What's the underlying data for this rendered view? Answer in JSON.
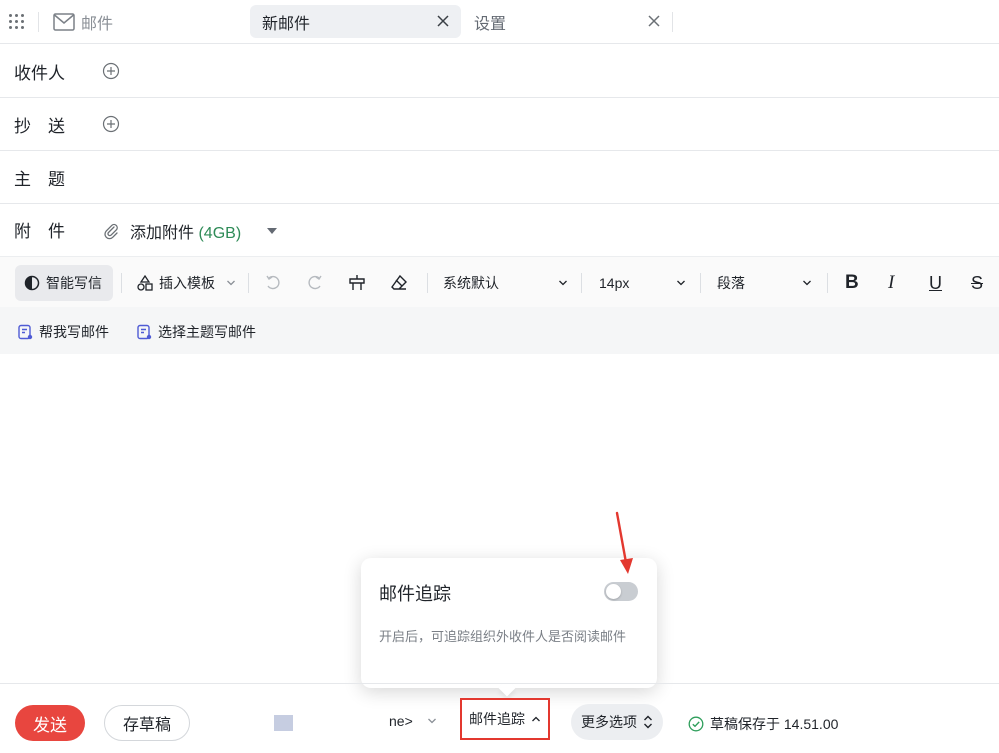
{
  "topbar": {
    "apps_icon": "grid-dots-icon",
    "mail_label": "邮件",
    "tabs": [
      {
        "label": "新邮件",
        "active": true
      },
      {
        "label": "设置",
        "active": false
      }
    ]
  },
  "form": {
    "to_label": "收件人",
    "cc_label": "抄　送",
    "subject_label": "主　题",
    "attach_label": "附　件",
    "attach_action": "添加附件",
    "attach_limit": "(4GB)"
  },
  "toolbar": {
    "ai_write": "智能写信",
    "insert_template": "插入模板",
    "font_family": "系统默认",
    "font_size": "14px",
    "paragraph": "段落",
    "bold": "B",
    "italic": "I",
    "underline": "U",
    "strike": "S"
  },
  "quick_actions": {
    "help_write": "帮我写邮件",
    "topic_write": "选择主题写邮件"
  },
  "popover": {
    "title": "邮件追踪",
    "toggle_on": false,
    "description": "开启后，可追踪组织外收件人是否阅读邮件"
  },
  "bottombar": {
    "send": "发送",
    "save_draft": "存草稿",
    "truncated": "ne>",
    "tracking": "邮件追踪",
    "more_options": "更多选项",
    "draft_status": "草稿保存于 14.51.00"
  },
  "colors": {
    "send_bg": "#e8463f",
    "highlight_border": "#e3382f",
    "attach_size": "#2e8b57",
    "saved_check": "#2e9e5b"
  }
}
